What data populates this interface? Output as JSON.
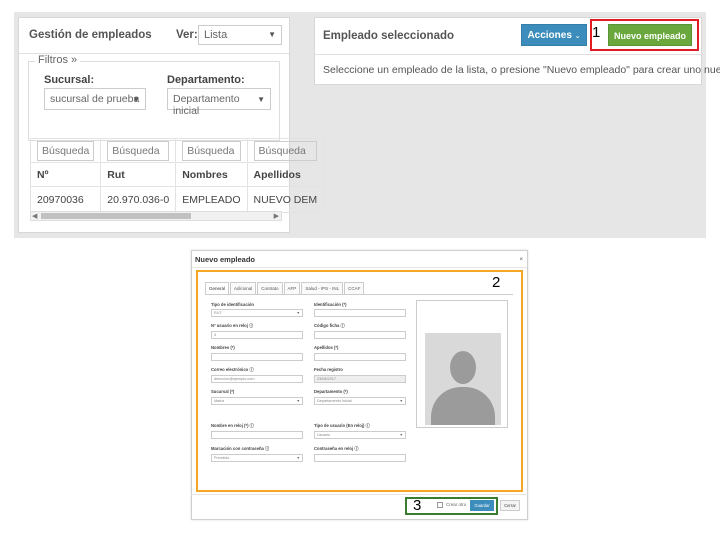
{
  "left_panel": {
    "title": "Gestión de empleados",
    "view_label": "Ver:",
    "view_value": "Lista",
    "filters_legend": "Filtros »",
    "sucursal_label": "Sucursal:",
    "sucursal_value": "sucursal de prueba",
    "departamento_label": "Departamento:",
    "departamento_value": "Departamento inicial",
    "table": {
      "search_placeholders": [
        "Búsqueda",
        "Búsqueda",
        "Búsqueda",
        "Búsqueda"
      ],
      "headers": [
        "Nº",
        "Rut",
        "Nombres",
        "Apellidos"
      ],
      "rows": [
        [
          "20970036",
          "20.970.036-0",
          "EMPLEADO",
          "NUEVO DEM"
        ]
      ]
    }
  },
  "right_panel": {
    "title": "Empleado seleccionado",
    "acciones_label": "Acciones",
    "nuevo_label": "Nuevo empleado",
    "message": "Seleccione un empleado de la lista, o presione \"Nuevo empleado\" para crear uno nuevo."
  },
  "annotations": {
    "one": "1",
    "two": "2",
    "three": "3"
  },
  "modal": {
    "title": "Nuevo empleado",
    "close": "×",
    "tabs": [
      "General",
      "Adicional",
      "Contrato",
      "AFP",
      "Salud - IPS - INL",
      "CCAF"
    ],
    "fields": {
      "tipo_ident_label": "Tipo de identificación",
      "tipo_ident_value": "RUT",
      "ident_label": "Identificación (*)",
      "usuario_reloj_label": "Nº usuario en reloj ⓘ",
      "usuario_reloj_value": "3",
      "codigo_ficha_label": "Código ficha ⓘ",
      "nombres_label": "Nombres (*)",
      "apellidos_label": "Apellidos (*)",
      "correo_label": "Correo electrónico ⓘ",
      "correo_value": "direccion@ejemplo.com",
      "fecha_label": "Fecha registro",
      "fecha_value": "23/08/2017",
      "sucursal_label": "Sucursal (*)",
      "sucursal_value": "Matriz",
      "depto_label": "Departamento (*)",
      "depto_value": "Departamento inicial",
      "nombre_reloj_label": "Nombre en reloj (*) ⓘ",
      "tipo_usuario_label": "Tipo de usuario (En reloj) ⓘ",
      "tipo_usuario_value": "Usuario",
      "marcacion_label": "Marcación con contraseña ⓘ",
      "marcacion_value": "Prendido",
      "contrasena_label": "Contraseña en reloj ⓘ"
    },
    "footer": {
      "crear_otro_label": "Crear otro",
      "guardar_label": "Guardar",
      "cerrar_label": "Cerrar"
    }
  }
}
